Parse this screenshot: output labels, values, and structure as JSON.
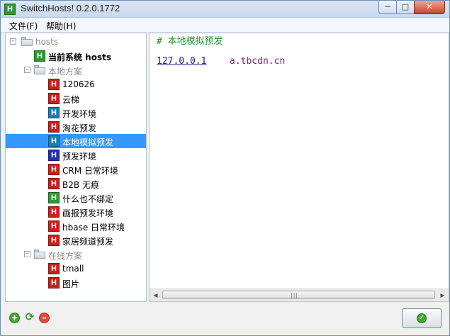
{
  "window": {
    "title": "SwitchHosts! 0.2.0.1772",
    "app_icon_letter": "H"
  },
  "menu": {
    "file": "文件(F)",
    "help": "帮助(H)"
  },
  "tree": {
    "root": {
      "label": "hosts"
    },
    "current": {
      "label": "当前系统 hosts",
      "color": "#2f9a2f"
    },
    "local": {
      "label": "本地方案",
      "items": [
        {
          "label": "120626",
          "color": "#c8201c"
        },
        {
          "label": "云梯",
          "color": "#c8201c"
        },
        {
          "label": "开发环境",
          "color": "#1a7fb0"
        },
        {
          "label": "淘花预发",
          "color": "#c8201c"
        },
        {
          "label": "本地模拟预发",
          "color": "#1a7fb0",
          "selected": true
        },
        {
          "label": "预发环境",
          "color": "#2232a8"
        },
        {
          "label": "CRM 日常环境",
          "color": "#c8201c"
        },
        {
          "label": "B2B 无痕",
          "color": "#c8201c"
        },
        {
          "label": "什么也不绑定",
          "color": "#2f9a2f"
        },
        {
          "label": "画报预发环境",
          "color": "#c8201c"
        },
        {
          "label": "hbase 日常环境",
          "color": "#c8201c"
        },
        {
          "label": "家居频道预发",
          "color": "#c8201c"
        }
      ]
    },
    "online": {
      "label": "在线方案",
      "items": [
        {
          "label": "tmall",
          "color": "#c8201c"
        },
        {
          "label": "图片",
          "color": "#c8201c"
        }
      ]
    }
  },
  "editor": {
    "comment": "# 本地模拟预发",
    "ip": "127.0.0.1",
    "host": "a.tbcdn.cn"
  }
}
